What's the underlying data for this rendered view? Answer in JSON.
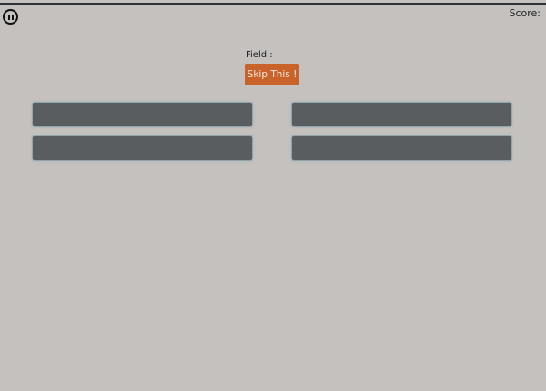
{
  "header": {
    "pause_icon": "pause-circle-icon",
    "score_label": "Score:"
  },
  "question": {
    "field_label": "Field :"
  },
  "skip_button": {
    "label": "Skip This !",
    "color": "#c9632a"
  },
  "answers": [
    "",
    "",
    "",
    ""
  ],
  "colors": {
    "background": "#c4c1bf",
    "answer_button": "#595d60"
  }
}
